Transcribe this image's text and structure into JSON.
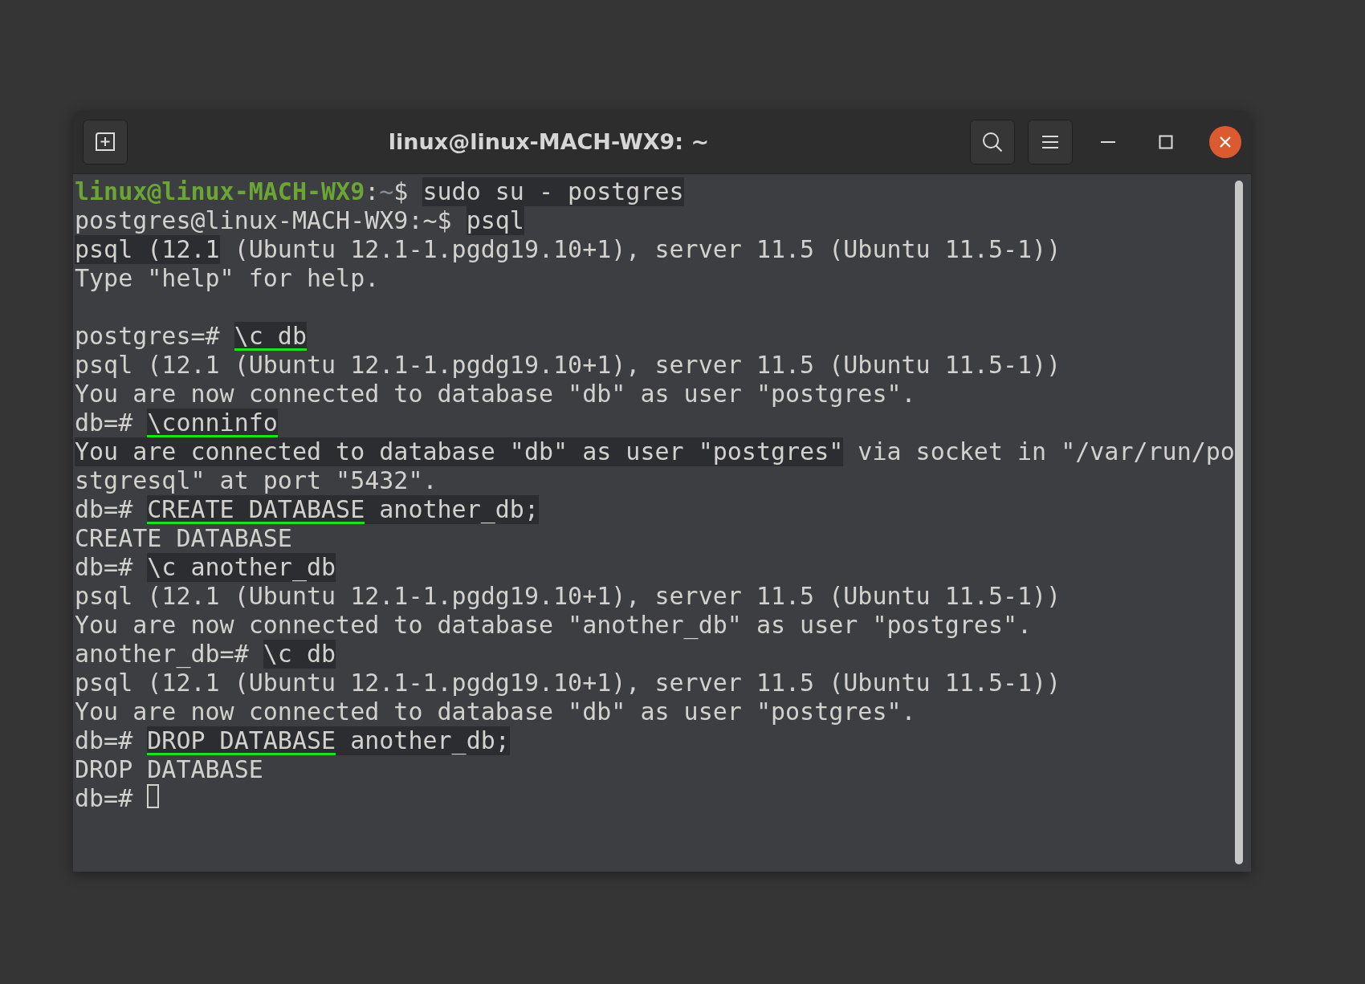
{
  "window": {
    "title": "linux@linux-MACH-WX9: ~"
  },
  "lines": [
    {
      "segments": [
        {
          "text": "linux@linux-MACH-WX9",
          "kind": "user"
        },
        {
          "text": ":",
          "kind": "text"
        },
        {
          "text": "~",
          "kind": "path"
        },
        {
          "text": "$ ",
          "kind": "text"
        },
        {
          "text": "sudo su - postgres",
          "kind": "text",
          "highlight": true
        }
      ]
    },
    {
      "segments": [
        {
          "text": "postgres@linux-MACH-WX9:~$ ",
          "kind": "text"
        },
        {
          "text": "psql",
          "kind": "text",
          "highlight": true
        }
      ]
    },
    {
      "segments": [
        {
          "text": "psql (12.1",
          "kind": "text",
          "highlight": true
        },
        {
          "text": " (Ubuntu 12.1-1.pgdg19.10+1), server 11.5 (Ubuntu 11.5-1))",
          "kind": "text"
        }
      ]
    },
    {
      "segments": [
        {
          "text": "Type \"help\" for help.",
          "kind": "text"
        }
      ]
    },
    {
      "blank_before": true,
      "segments": [
        {
          "text": "postgres=# ",
          "kind": "text"
        },
        {
          "text": "\\c db",
          "kind": "text",
          "highlight": true,
          "underline": true
        }
      ]
    },
    {
      "segments": [
        {
          "text": "psql (12.1 (Ubuntu 12.1-1.pgdg19.10+1), server 11.5 (Ubuntu 11.5-1))",
          "kind": "text"
        }
      ]
    },
    {
      "segments": [
        {
          "text": "You are now connected to database \"db\" as user \"postgres\".",
          "kind": "text"
        }
      ]
    },
    {
      "segments": [
        {
          "text": "db=# ",
          "kind": "text"
        },
        {
          "text": "\\conninfo",
          "kind": "text",
          "highlight": true,
          "underline": true
        }
      ]
    },
    {
      "segments": [
        {
          "text": "You are connected to database \"db\" as user \"postgres\"",
          "kind": "text",
          "highlight": true
        },
        {
          "text": " via socket in \"/var/run/po",
          "kind": "text"
        }
      ]
    },
    {
      "segments": [
        {
          "text": "stgresql\" at port \"5432\".",
          "kind": "text"
        }
      ]
    },
    {
      "segments": [
        {
          "text": "db=# ",
          "kind": "text"
        },
        {
          "text": "CREATE DATABASE",
          "kind": "text",
          "highlight": true,
          "underline": true
        },
        {
          "text": " another_db;",
          "kind": "text",
          "highlight": true
        }
      ]
    },
    {
      "segments": [
        {
          "text": "CREATE DATABASE",
          "kind": "text"
        }
      ]
    },
    {
      "segments": [
        {
          "text": "db=# ",
          "kind": "text"
        },
        {
          "text": "\\c another_db",
          "kind": "text",
          "highlight": true
        }
      ]
    },
    {
      "segments": [
        {
          "text": "psql (12.1 (Ubuntu 12.1-1.pgdg19.10+1), server 11.5 (Ubuntu 11.5-1))",
          "kind": "text"
        }
      ]
    },
    {
      "segments": [
        {
          "text": "You are now connected to database \"another_db\" as user \"postgres\".",
          "kind": "text"
        }
      ]
    },
    {
      "segments": [
        {
          "text": "another_db=# ",
          "kind": "text"
        },
        {
          "text": "\\c db",
          "kind": "text",
          "highlight": true
        }
      ]
    },
    {
      "segments": [
        {
          "text": "psql (12.1 (Ubuntu 12.1-1.pgdg19.10+1), server 11.5 (Ubuntu 11.5-1))",
          "kind": "text"
        }
      ]
    },
    {
      "segments": [
        {
          "text": "You are now connected to database \"db\" as user \"postgres\".",
          "kind": "text"
        }
      ]
    },
    {
      "segments": [
        {
          "text": "db=# ",
          "kind": "text"
        },
        {
          "text": "DROP DATABASE",
          "kind": "text",
          "highlight": true,
          "underline": true
        },
        {
          "text": " another_db;",
          "kind": "text",
          "highlight": true
        }
      ]
    },
    {
      "segments": [
        {
          "text": "DROP DATABASE",
          "kind": "text"
        }
      ]
    },
    {
      "segments": [
        {
          "text": "db=# ",
          "kind": "text"
        }
      ],
      "cursor": true
    }
  ]
}
